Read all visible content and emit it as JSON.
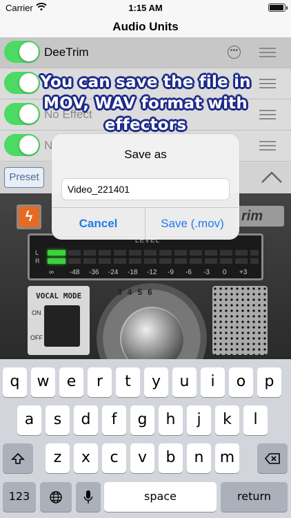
{
  "status_bar": {
    "carrier": "Carrier",
    "time": "1:15 AM"
  },
  "navbar": {
    "title": "Audio Units"
  },
  "list": {
    "items": [
      {
        "label": "DeeTrim",
        "enabled": true
      },
      {
        "label": "",
        "enabled": true
      },
      {
        "label": "No Effect",
        "enabled": true
      },
      {
        "label": "N",
        "enabled": true
      }
    ]
  },
  "banner": {
    "line1": "You can save the file in",
    "line2": "MOV, WAV format with effectors"
  },
  "preset": {
    "label": "Preset"
  },
  "plugin": {
    "logo": "rim",
    "meter_title": "LEVEL",
    "meter_l": "L",
    "meter_r": "R",
    "scale": [
      "∞",
      "-48",
      "-36",
      "-24",
      "-18",
      "-12",
      "-9",
      "-6",
      "-3",
      "0",
      "+3"
    ],
    "vocal_mode": "VOCAL MODE",
    "on": "ON",
    "off": "OFF",
    "knob_numbers": "3456"
  },
  "dialog": {
    "title": "Save as",
    "filename": "Video_221401",
    "cancel": "Cancel",
    "save": "Save (.mov)"
  },
  "keyboard": {
    "row1": [
      "q",
      "w",
      "e",
      "r",
      "t",
      "y",
      "u",
      "i",
      "o",
      "p"
    ],
    "row2": [
      "a",
      "s",
      "d",
      "f",
      "g",
      "h",
      "j",
      "k",
      "l"
    ],
    "row3": [
      "z",
      "x",
      "c",
      "v",
      "b",
      "n",
      "m"
    ],
    "numbers_key": "123",
    "space_key": "space",
    "return_key": "return"
  }
}
